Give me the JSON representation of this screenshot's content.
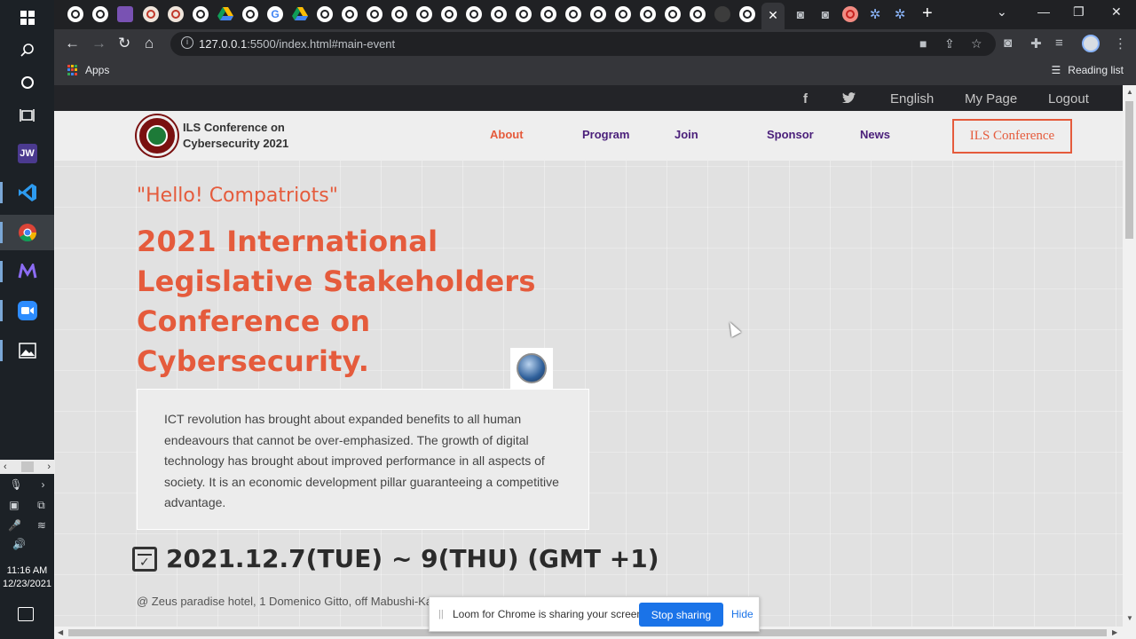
{
  "taskbar": {
    "jw_label": "JW",
    "time": "11:16 AM",
    "date": "12/23/2021"
  },
  "browser": {
    "active_tab_close": "✕",
    "new_tab": "+",
    "url_host": "127.0.0.1",
    "url_rest": ":5500/index.html#main-event",
    "bookmarks": {
      "apps": "Apps",
      "reading_list": "Reading list"
    }
  },
  "site": {
    "topbar": {
      "facebook_icon": "f",
      "language": "English",
      "my_page": "My Page",
      "logout": "Logout"
    },
    "brand": {
      "line1": "ILS Conference on",
      "line2": "Cybersecurity 2021"
    },
    "nav": {
      "about": "About",
      "program": "Program",
      "join": "Join",
      "sponsor": "Sponsor",
      "news": "News",
      "cta": "ILS Conference"
    },
    "hero": {
      "greeting": "\"Hello! Compatriots\"",
      "headline": "2021 International Legislative Stakeholders Conference on Cybersecurity.",
      "intro": "ICT revolution has brought about expanded benefits to all human endeavours that cannot be over-emphasized. The growth of digital technology has brought about improved performance in all aspects of society. It is an economic development pillar guaranteeing a competitive advantage.",
      "date": "2021.12.7(TUE) ~ 9(THU) (GMT +1)",
      "venue": "@ Zeus paradise hotel, 1 Domenico Gitto, off Mabushi-Katampe Road, Abuja"
    }
  },
  "loom": {
    "message": "Loom for Chrome is sharing your screen.",
    "stop_label": "Stop sharing",
    "hide_label": "Hide"
  },
  "colors": {
    "accent": "#e55b3c",
    "nav_text": "#4a1f7a",
    "topbar_bg": "#232428",
    "loom_blue": "#1a73e8"
  }
}
